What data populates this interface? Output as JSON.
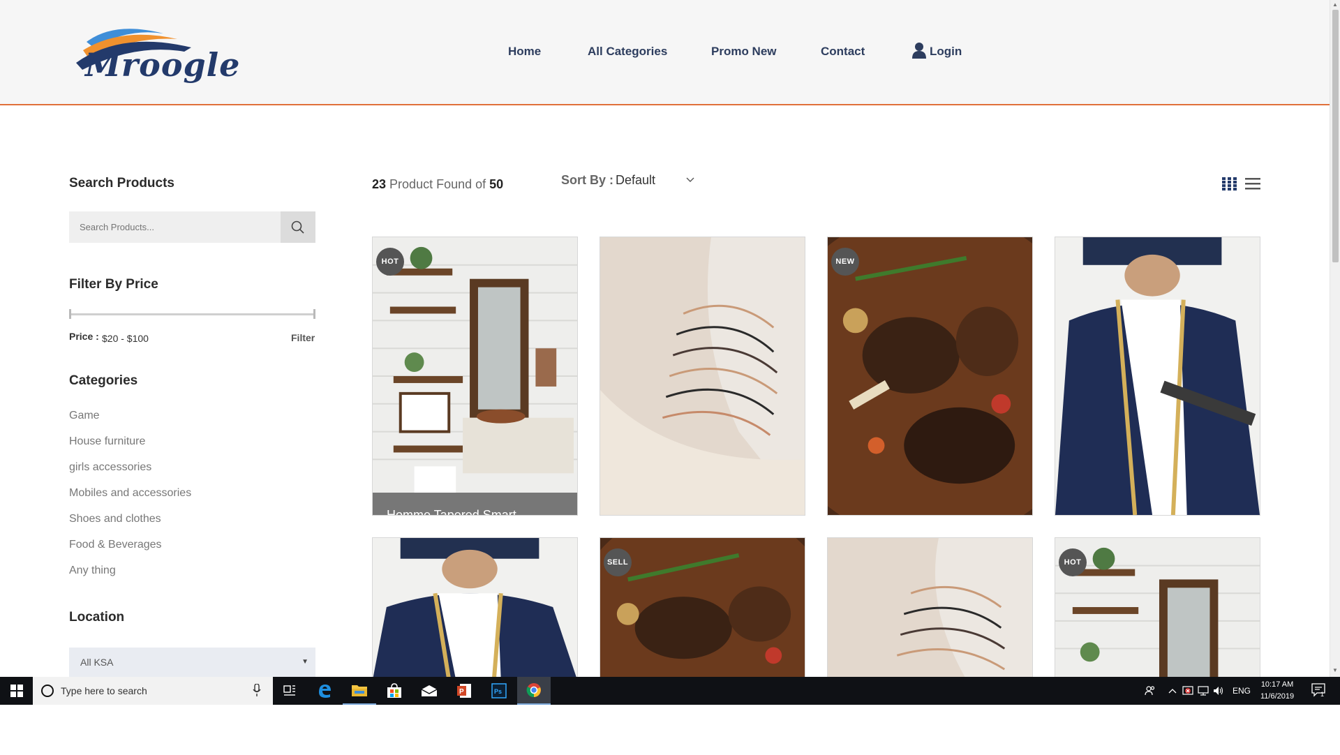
{
  "header": {
    "logo_text": "Mroogle",
    "nav": [
      {
        "label": "Home"
      },
      {
        "label": "All Categories"
      },
      {
        "label": "Promo New"
      },
      {
        "label": "Contact"
      },
      {
        "label": "Login",
        "icon": "user-icon"
      }
    ]
  },
  "sidebar": {
    "search_heading": "Search Products",
    "search_placeholder": "Search Products...",
    "price_heading": "Filter By Price",
    "price_label": "Price :",
    "price_value": "$20 - $100",
    "filter_label": "Filter",
    "categories_heading": "Categories",
    "categories": [
      "Game",
      "House furniture",
      "girls accessories",
      "Mobiles and accessories",
      "Shoes and clothes",
      "Food & Beverages",
      "Any thing"
    ],
    "location_heading": "Location",
    "location_value": "All KSA"
  },
  "results": {
    "found_count": "23",
    "found_text": "Product Found of",
    "total_count": "50",
    "sort_label": "Sort By :",
    "sort_value": "Default"
  },
  "products": [
    {
      "badge": "HOT",
      "image": "bathroom-shelves",
      "title": "Homme Tapered Smart"
    },
    {
      "badge": "",
      "image": "bracelets",
      "title": ""
    },
    {
      "badge": "NEW",
      "image": "roasted-lamb",
      "title": ""
    },
    {
      "badge": "",
      "image": "traditional-robe",
      "title": ""
    },
    {
      "badge": "",
      "image": "traditional-robe",
      "title": ""
    },
    {
      "badge": "SELL",
      "image": "roasted-lamb",
      "title": ""
    },
    {
      "badge": "",
      "image": "bracelets",
      "title": ""
    },
    {
      "badge": "HOT",
      "image": "bathroom-shelves",
      "title": ""
    }
  ],
  "taskbar": {
    "search_placeholder": "Type here to search",
    "language": "ENG",
    "time": "10:17 AM",
    "date": "11/6/2019",
    "notification_count": "1"
  },
  "colors": {
    "accent": "#e0703a",
    "nav_text": "#2d3d5e",
    "logo_blue": "#233a6b",
    "logo_orange": "#f0912e",
    "logo_light_blue": "#3f8ed8"
  }
}
